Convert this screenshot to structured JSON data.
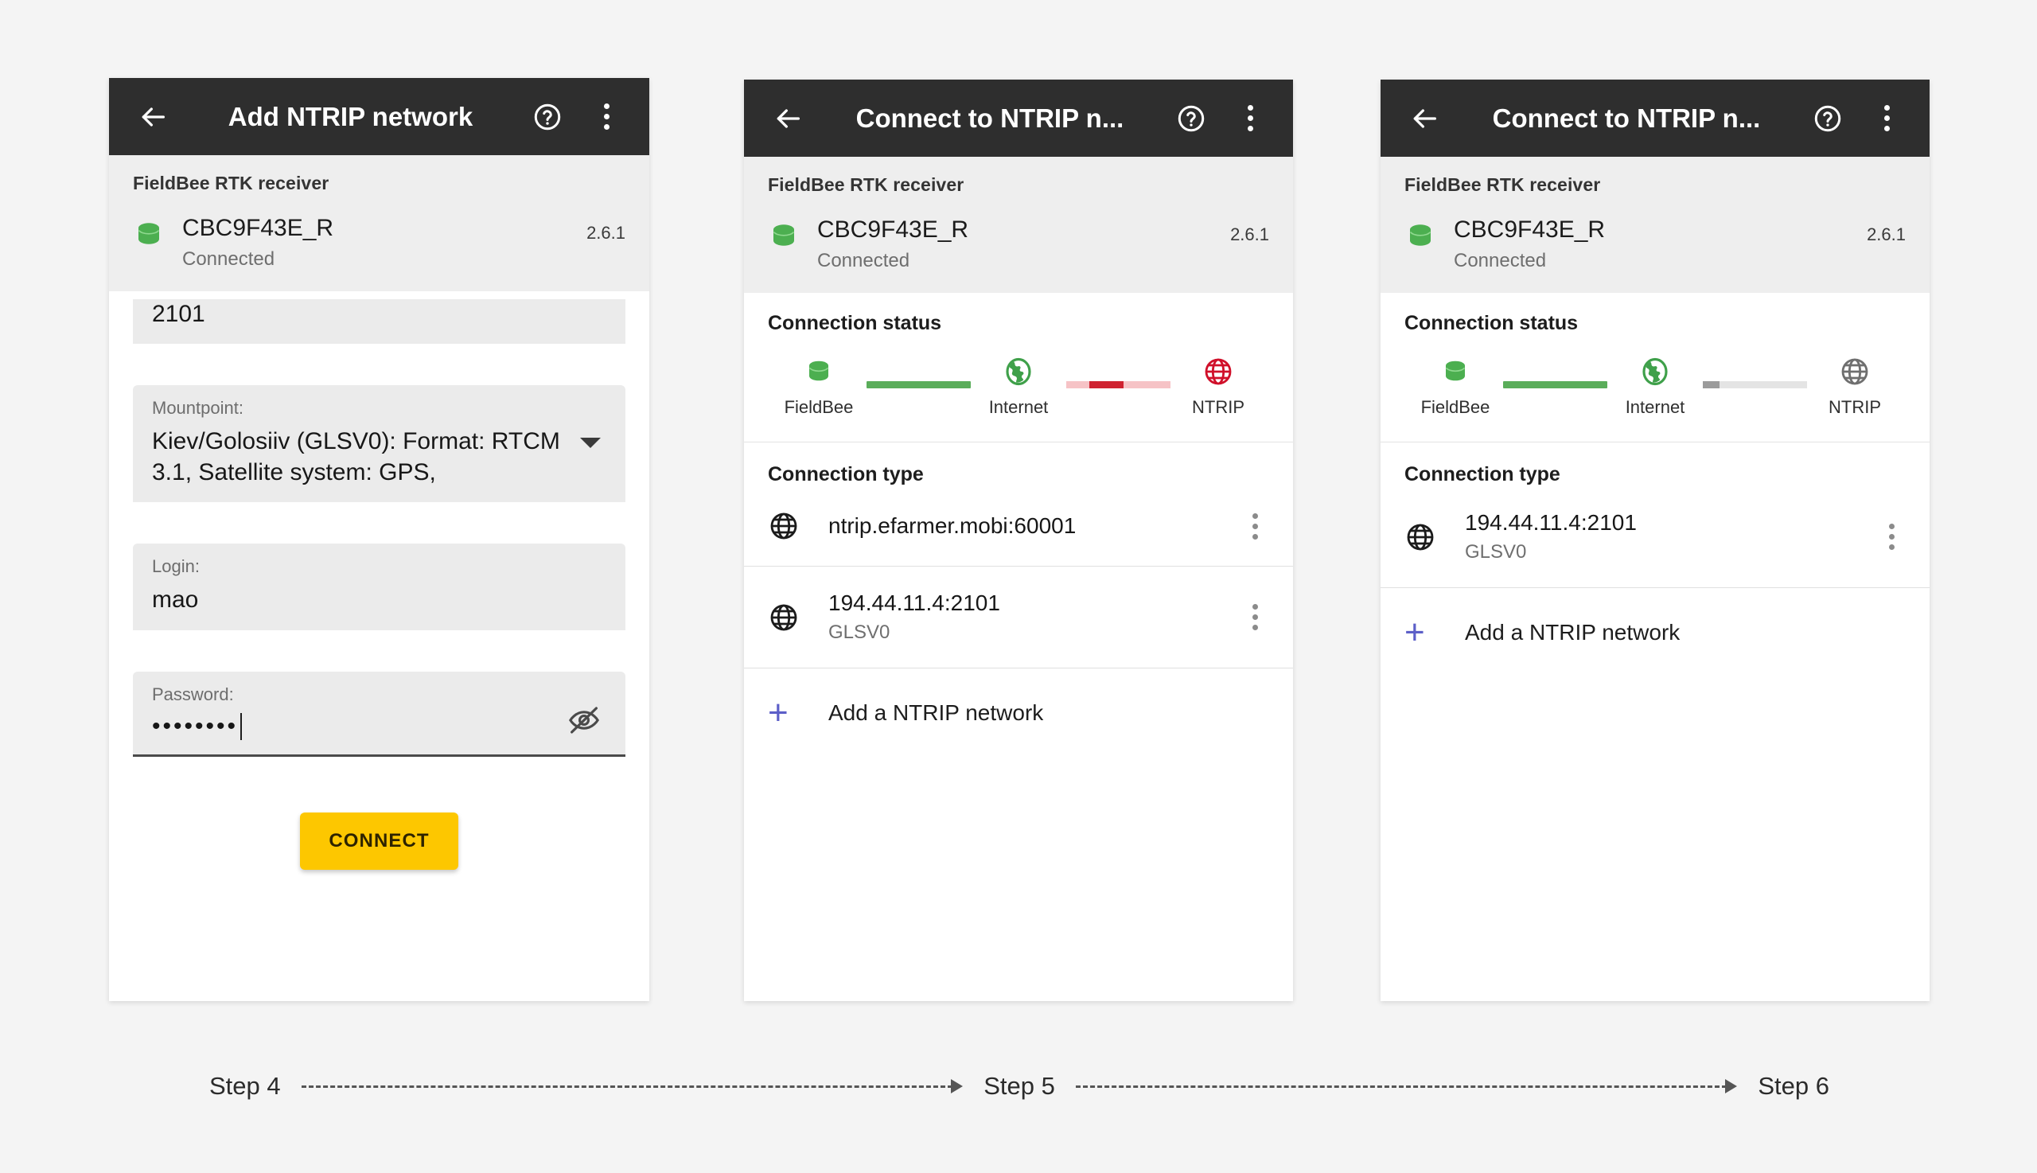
{
  "background_color": "#f4f4f4",
  "accent_colors": {
    "appbar": "#2e2e2e",
    "connect_button": "#fdc700",
    "add_plus": "#5c5fc8",
    "ok_green": "#5aad5a",
    "error_red": "#cf2230",
    "idle_grey": "#9b9b9b"
  },
  "panels": [
    {
      "id": "panel-1",
      "appbar": {
        "back_icon": "arrow-back-icon",
        "title": "Add NTRIP network",
        "help_icon": "help-circle-icon",
        "overflow_icon": "more-vertical-icon"
      },
      "receiver": {
        "section_label": "FieldBee RTK receiver",
        "icon": "receiver-green-icon",
        "name": "CBC9F43E_R",
        "status": "Connected",
        "version": "2.6.1"
      },
      "form": {
        "port": {
          "value": "2101"
        },
        "mountpoint": {
          "label": "Mountpoint:",
          "value": "Kiev/Golosiiv (GLSV0): Format: RTCM 3.1, Satellite system: GPS,",
          "caret_icon": "chevron-down-icon"
        },
        "login": {
          "label": "Login:",
          "value": "mao"
        },
        "password": {
          "label": "Password:",
          "value": "••••••••",
          "reveal_icon": "eye-off-icon"
        },
        "connect_label": "CONNECT"
      }
    },
    {
      "id": "panel-2",
      "appbar": {
        "back_icon": "arrow-back-icon",
        "title": "Connect to NTRIP n...",
        "help_icon": "help-circle-icon",
        "overflow_icon": "more-vertical-icon"
      },
      "receiver": {
        "section_label": "FieldBee RTK receiver",
        "icon": "receiver-green-icon",
        "name": "CBC9F43E_R",
        "status": "Connected",
        "version": "2.6.1"
      },
      "connection_status": {
        "heading": "Connection status",
        "nodes": [
          {
            "label": "FieldBee",
            "icon": "receiver-green-icon",
            "state": "ok"
          },
          {
            "label": "Internet",
            "icon": "globe-green-icon",
            "state": "ok"
          },
          {
            "label": "NTRIP",
            "icon": "globe-red-icon",
            "state": "error"
          }
        ],
        "links": [
          {
            "from": "FieldBee",
            "to": "Internet",
            "state": "ok"
          },
          {
            "from": "Internet",
            "to": "NTRIP",
            "state": "error"
          }
        ]
      },
      "connection_type": {
        "heading": "Connection type",
        "networks": [
          {
            "icon": "globe-icon",
            "host": "ntrip.efarmer.mobi:60001",
            "mountpoint": "",
            "menu_icon": "more-vertical-icon"
          },
          {
            "icon": "globe-icon",
            "host": "194.44.11.4:2101",
            "mountpoint": "GLSV0",
            "menu_icon": "more-vertical-icon"
          }
        ],
        "add_label": "Add a NTRIP network",
        "add_icon": "plus-icon"
      }
    },
    {
      "id": "panel-3",
      "appbar": {
        "back_icon": "arrow-back-icon",
        "title": "Connect to NTRIP n...",
        "help_icon": "help-circle-icon",
        "overflow_icon": "more-vertical-icon"
      },
      "receiver": {
        "section_label": "FieldBee RTK receiver",
        "icon": "receiver-green-icon",
        "name": "CBC9F43E_R",
        "status": "Connected",
        "version": "2.6.1"
      },
      "connection_status": {
        "heading": "Connection status",
        "nodes": [
          {
            "label": "FieldBee",
            "icon": "receiver-green-icon",
            "state": "ok"
          },
          {
            "label": "Internet",
            "icon": "globe-green-icon",
            "state": "ok"
          },
          {
            "label": "NTRIP",
            "icon": "globe-grey-icon",
            "state": "idle"
          }
        ],
        "links": [
          {
            "from": "FieldBee",
            "to": "Internet",
            "state": "ok"
          },
          {
            "from": "Internet",
            "to": "NTRIP",
            "state": "connecting"
          }
        ]
      },
      "connection_type": {
        "heading": "Connection type",
        "networks": [
          {
            "icon": "globe-icon",
            "host": "194.44.11.4:2101",
            "mountpoint": "GLSV0",
            "menu_icon": "more-vertical-icon"
          }
        ],
        "add_label": "Add a NTRIP network",
        "add_icon": "plus-icon"
      }
    }
  ],
  "steps": {
    "step_a": "Step 4",
    "step_b": "Step 5",
    "step_c": "Step 6"
  }
}
